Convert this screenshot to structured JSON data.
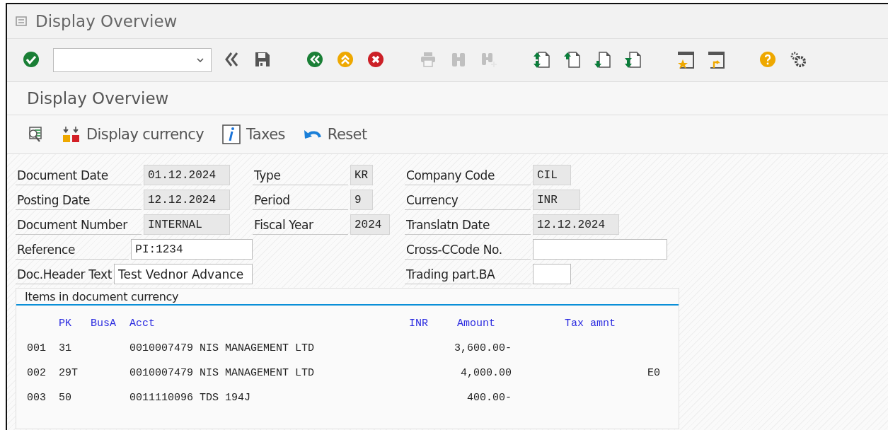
{
  "window": {
    "title": "Display Overview"
  },
  "toolbar": [
    {
      "kind": "enter",
      "disabled": false
    },
    {
      "kind": "command_field"
    },
    {
      "kind": "collapse",
      "disabled": false
    },
    {
      "kind": "save",
      "disabled": false
    },
    {
      "kind": "back",
      "disabled": false
    },
    {
      "kind": "exit",
      "disabled": false
    },
    {
      "kind": "cancel",
      "disabled": false
    },
    {
      "kind": "print",
      "disabled": true
    },
    {
      "kind": "find",
      "disabled": true
    },
    {
      "kind": "find_next",
      "disabled": true
    },
    {
      "kind": "first_page",
      "disabled": false
    },
    {
      "kind": "previous_page",
      "disabled": false
    },
    {
      "kind": "next_page",
      "disabled": false
    },
    {
      "kind": "last_page",
      "disabled": false
    },
    {
      "kind": "new_session",
      "disabled": false
    },
    {
      "kind": "shortcut",
      "disabled": false
    },
    {
      "kind": "help",
      "disabled": false
    },
    {
      "kind": "settings",
      "disabled": false
    }
  ],
  "screen_title": "Display Overview",
  "app_toolbar": [
    {
      "kind": "search_list"
    },
    {
      "kind": "currency",
      "label": "Display currency"
    },
    {
      "kind": "info",
      "label": "Taxes"
    },
    {
      "kind": "undo",
      "label": "Reset"
    }
  ],
  "header_rows": [
    {
      "left": {
        "label": "Document Date",
        "value": "01.12.2024",
        "editable": false
      },
      "middle": {
        "label": "Type",
        "value": "KR",
        "editable": false
      },
      "right": {
        "label": "Company Code",
        "value": "CIL",
        "editable": false
      }
    },
    {
      "left": {
        "label": "Posting Date",
        "value": "12.12.2024",
        "editable": false
      },
      "middle": {
        "label": "Period",
        "value": "9",
        "editable": false
      },
      "right": {
        "label": "Currency",
        "value": "INR",
        "editable": false
      }
    },
    {
      "left": {
        "label": "Document Number",
        "value": "INTERNAL",
        "editable": false
      },
      "middle": {
        "label": "Fiscal Year",
        "value": "2024",
        "editable": false
      },
      "right": {
        "label": "Translatn Date",
        "value": "12.12.2024",
        "editable": false
      }
    },
    {
      "left": {
        "label": "Reference",
        "value": "PI:1234",
        "editable": true
      },
      "right": {
        "label": "Cross-CCode No.",
        "editable": true
      }
    },
    {
      "left": {
        "label": "Doc.Header Text",
        "value": "Test Vednor Advance",
        "editable": true
      },
      "right": {
        "label": "Trading part.BA",
        "editable": true
      }
    }
  ],
  "items": {
    "title": "Items in document currency",
    "columns": [
      "PK",
      "BusA",
      "Acct",
      "INR",
      "Amount",
      "Tax amnt"
    ],
    "rows": [
      {
        "item": "001",
        "pk": "31",
        "account": "0010007479 NIS MANAGEMENT LTD",
        "amount": "3,600.00-"
      },
      {
        "item": "002",
        "pk": "29T",
        "account": "0010007479 NIS MANAGEMENT LTD",
        "amount": "4,000.00",
        "column_8": "E0"
      },
      {
        "item": "003",
        "pk": "50",
        "account": "0011110096 TDS 194J",
        "amount": "400.00-"
      }
    ]
  }
}
